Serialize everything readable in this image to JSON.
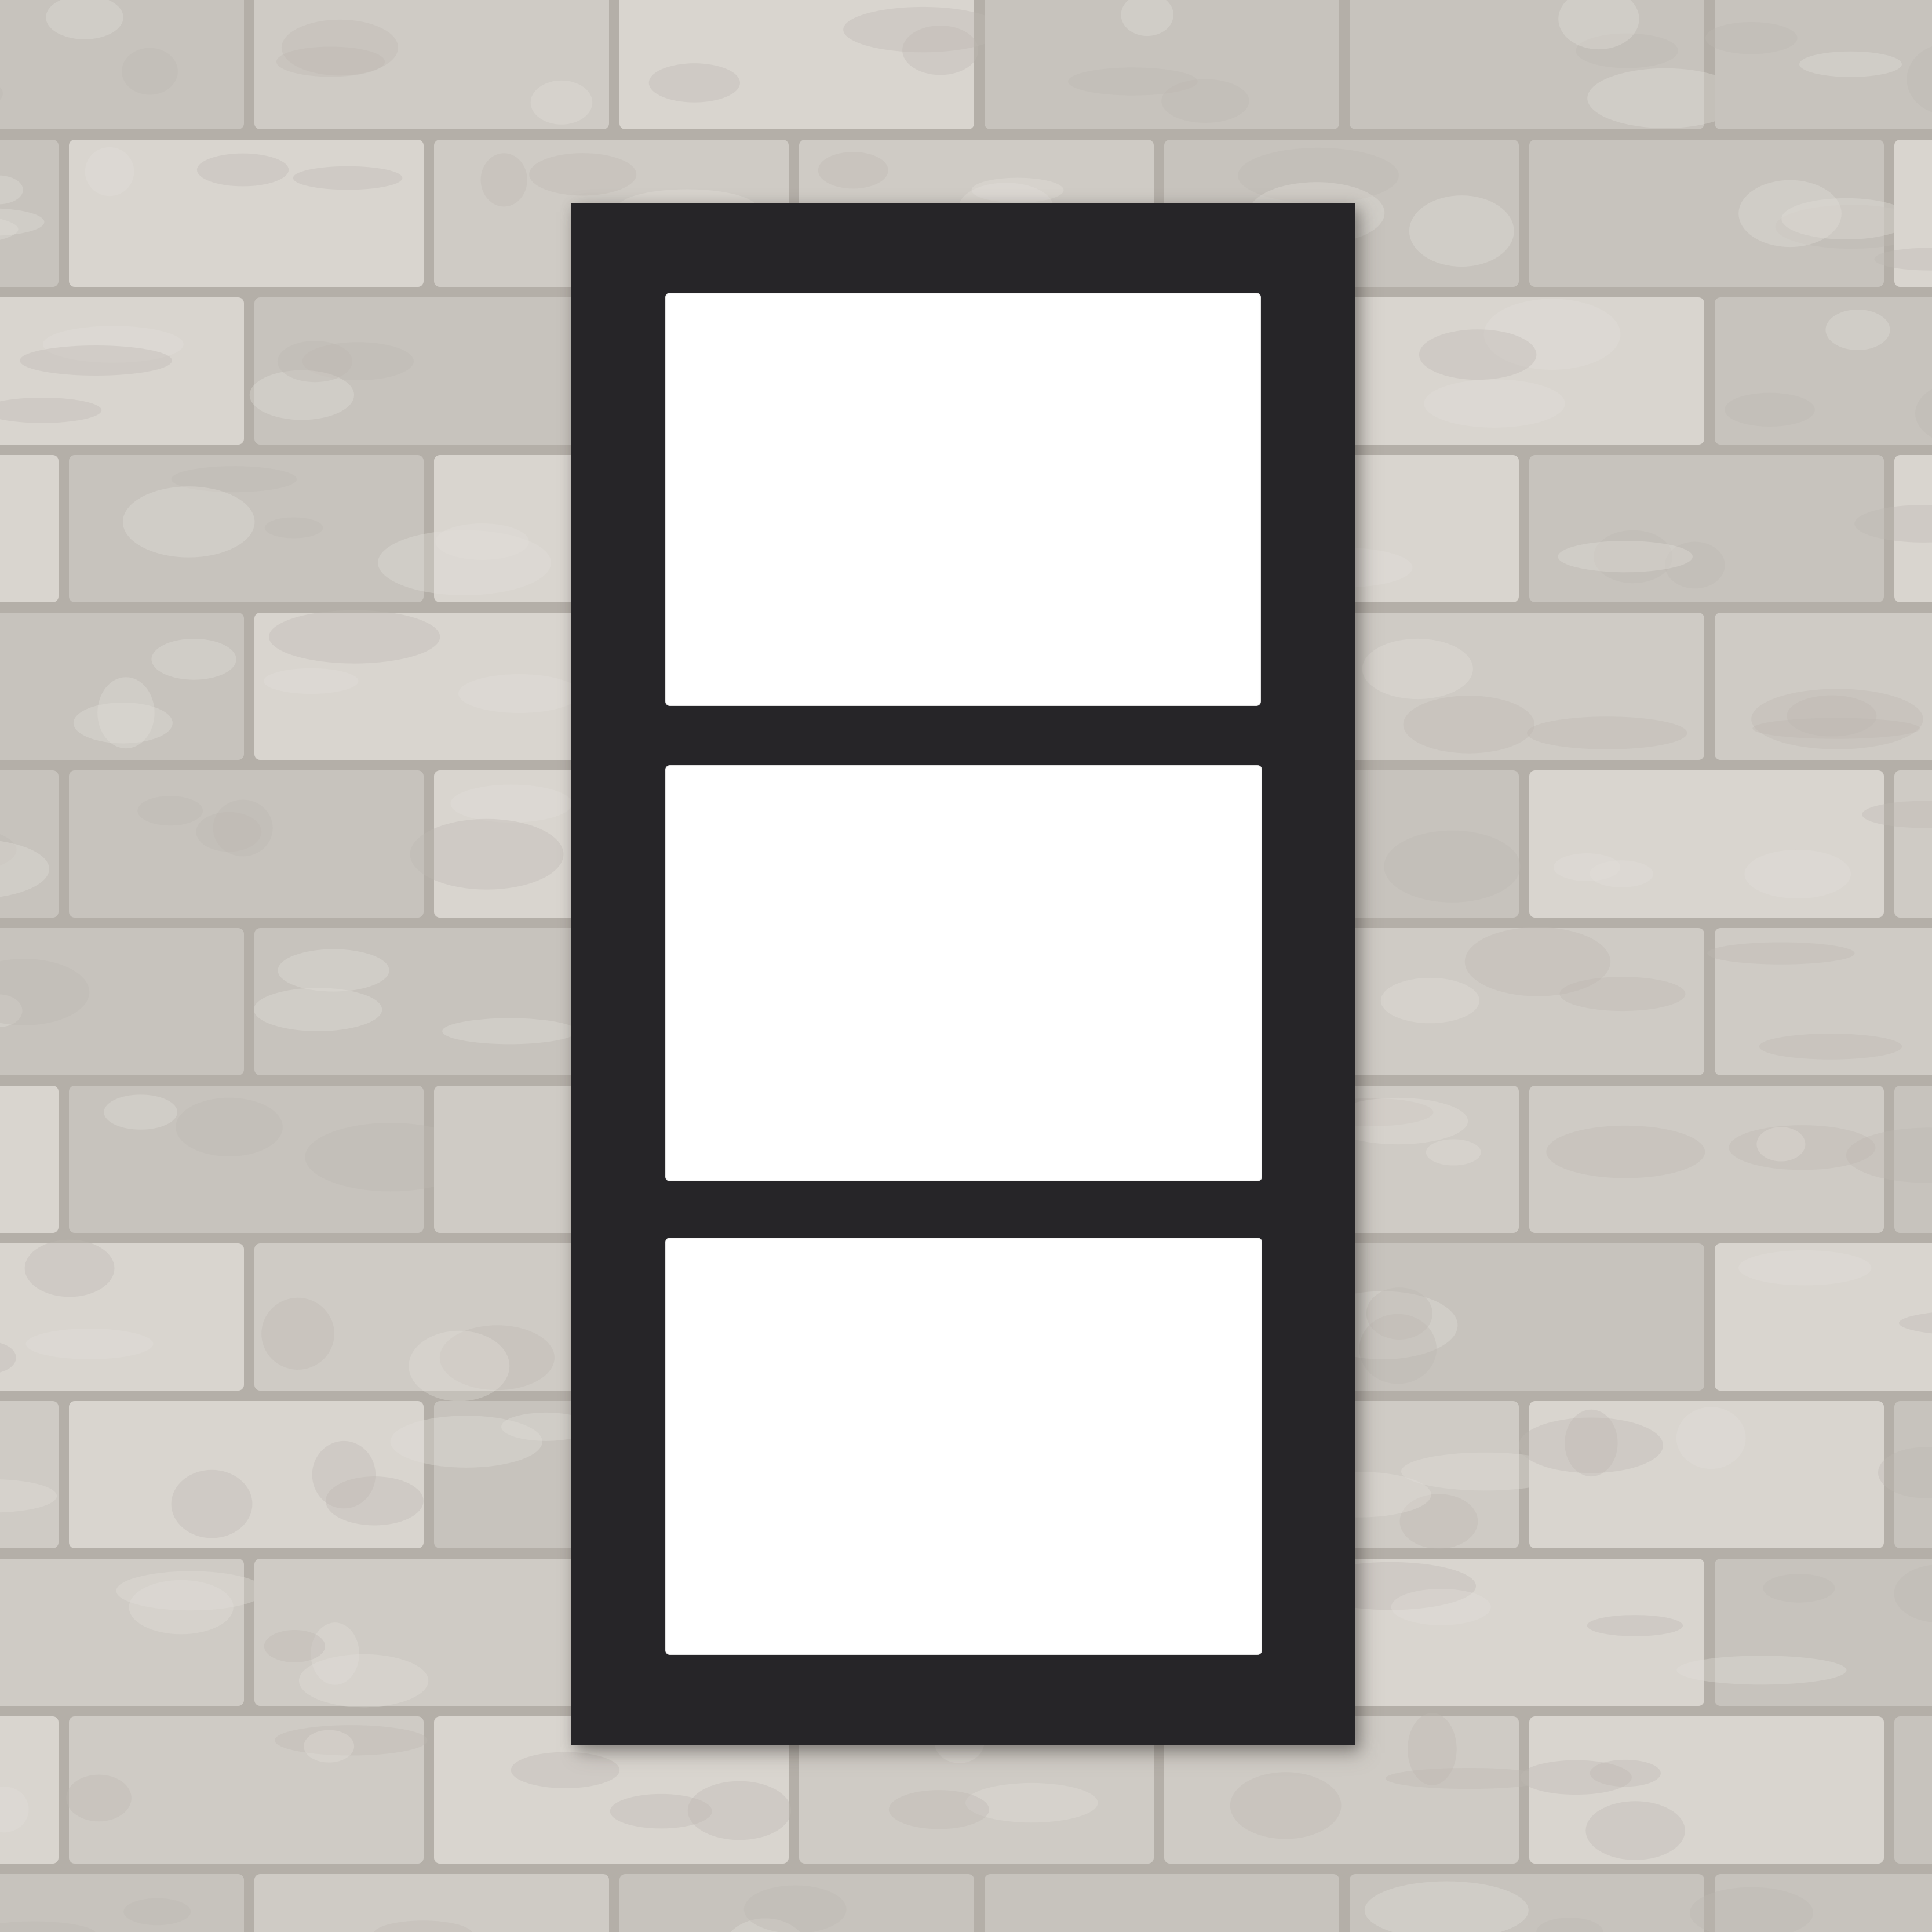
{
  "scene": {
    "subject": "three-opening-picture-frame",
    "colors": {
      "wall_base": "#cfcbc5",
      "brick_light": "#d9d5cf",
      "brick_mid": "#c7c3bd",
      "mortar": "#b4afa8",
      "frame": "#262528",
      "opening": "#ffffff"
    },
    "frame": {
      "openings_count": 3
    }
  }
}
